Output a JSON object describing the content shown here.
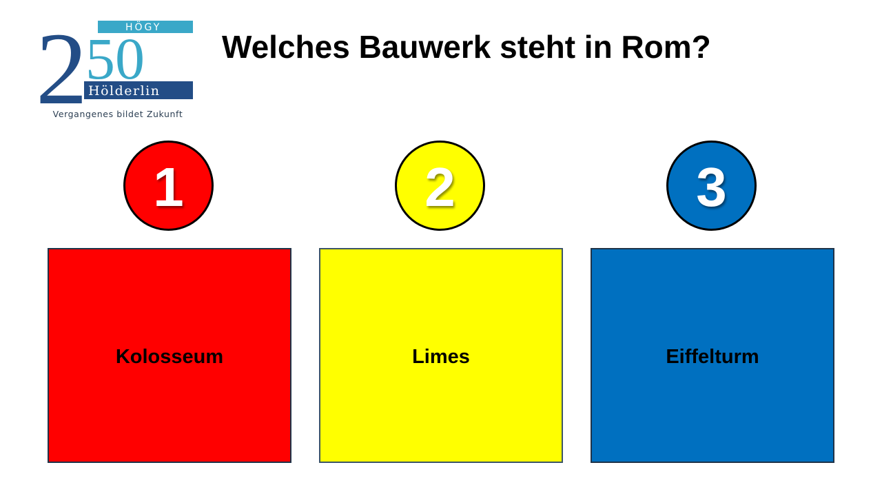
{
  "logo": {
    "number": "250",
    "school_short": "HÖGY",
    "school_name": "Hölderlin",
    "tagline": "Vergangenes bildet Zukunft",
    "colors": {
      "dark_blue": "#234d86",
      "light_blue": "#3aa8c8"
    }
  },
  "question": "Welches Bauwerk steht in Rom?",
  "options": [
    {
      "number": "1",
      "answer": "Kolosseum",
      "color": "#ff0000"
    },
    {
      "number": "2",
      "answer": "Limes",
      "color": "#ffff00"
    },
    {
      "number": "3",
      "answer": "Eiffelturm",
      "color": "#0070c0"
    }
  ]
}
